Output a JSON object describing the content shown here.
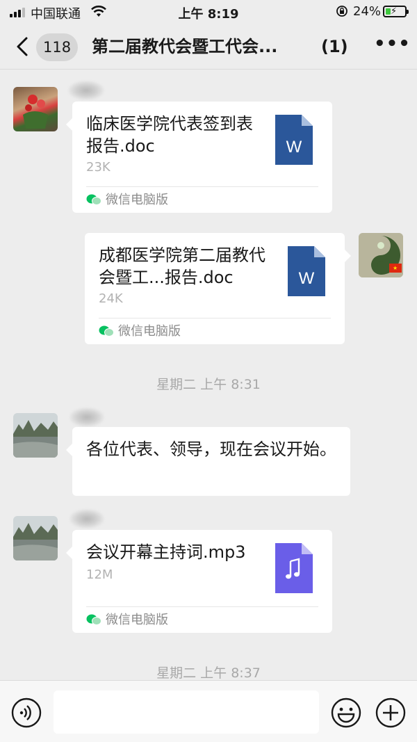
{
  "status_bar": {
    "carrier": "中国联通",
    "time": "上午 8:19",
    "battery_percent": "24%"
  },
  "nav": {
    "back_badge": "118",
    "title": "第二届教代会暨工代会...",
    "member_count": "(1)"
  },
  "messages": {
    "m1": {
      "file_name": "临床医学院代表签到表报告.doc",
      "file_size": "23K",
      "source": "微信电脑版",
      "file_icon": "word-doc-icon"
    },
    "m2": {
      "file_name": "成都医学院第二届教代会暨工...报告.doc",
      "file_size": "24K",
      "source": "微信电脑版",
      "file_icon": "word-doc-icon"
    },
    "time1": "星期二 上午 8:31",
    "m3": {
      "text": "各位代表、领导，现在会议开始。"
    },
    "m4": {
      "file_name": "会议开幕主持词.mp3",
      "file_size": "12M",
      "source": "微信电脑版",
      "file_icon": "music-file-icon"
    },
    "time2": "星期二 上午 8:37"
  },
  "input_bar": {
    "voice_icon": "voice-icon",
    "emoji_icon": "emoji-icon",
    "plus_icon": "plus-icon"
  },
  "colors": {
    "word_blue": "#2b579a",
    "music_purple": "#6a5ee8",
    "wechat_green": "#07c160",
    "background": "#ededed"
  }
}
